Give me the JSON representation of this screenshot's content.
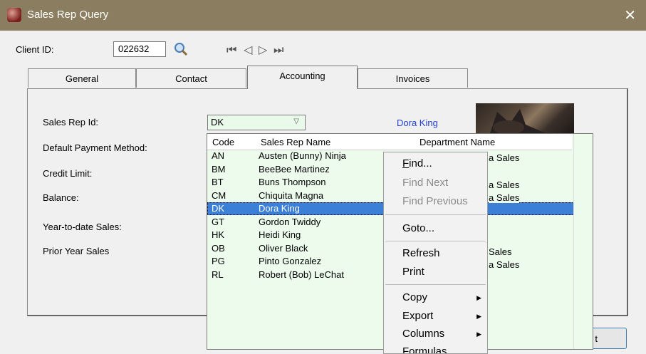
{
  "window": {
    "title": "Sales Rep Query",
    "close_glyph": "✕"
  },
  "client": {
    "label": "Client ID:",
    "value": "022632"
  },
  "nav": {
    "first": "⏮",
    "prev": "◁",
    "next": "▷",
    "last": "⏭"
  },
  "tabs": [
    {
      "label": "General"
    },
    {
      "label": "Contact"
    },
    {
      "label": "Accounting"
    },
    {
      "label": "Invoices"
    }
  ],
  "fields": {
    "sales_rep_id": "Sales Rep Id:",
    "default_payment": "Default Payment Method:",
    "credit_limit": "Credit Limit:",
    "balance": "Balance:",
    "ytd_sales": "Year-to-date Sales:",
    "prior_year_sales": "Prior Year Sales"
  },
  "rep": {
    "code": "DK",
    "name": "Dora King"
  },
  "dropdown": {
    "headers": {
      "code": "Code",
      "name": "Sales Rep Name",
      "dept": "Department Name"
    },
    "rows": [
      {
        "code": "AN",
        "name": "Austen (Bunny) Ninja"
      },
      {
        "code": "BM",
        "name": "BeeBee Martinez"
      },
      {
        "code": "BT",
        "name": "Buns Thompson"
      },
      {
        "code": "CM",
        "name": "Chiquita Magna"
      },
      {
        "code": "DK",
        "name": "Dora King"
      },
      {
        "code": "GT",
        "name": "Gordon Twiddy"
      },
      {
        "code": "HK",
        "name": "Heidi King"
      },
      {
        "code": "OB",
        "name": "Oliver Black"
      },
      {
        "code": "PG",
        "name": "Pinto Gonzalez"
      },
      {
        "code": "RL",
        "name": "Robert (Bob) LeChat"
      }
    ],
    "selected_code": "DK",
    "partial_dept": [
      "a Sales",
      "a Sales",
      "a Sales",
      "Sales",
      "a Sales"
    ]
  },
  "ok_button": {
    "label": "t"
  },
  "context_menu": {
    "find": "Find...",
    "find_next": "Find Next",
    "find_previous": "Find Previous",
    "goto": "Goto...",
    "refresh": "Refresh",
    "print": "Print",
    "copy": "Copy",
    "export": "Export",
    "columns": "Columns",
    "formulas": "Formulas"
  },
  "icons": {
    "app": "sales-query-icon",
    "search": "magnifier-icon",
    "submenu": "triangle-right-icon"
  }
}
